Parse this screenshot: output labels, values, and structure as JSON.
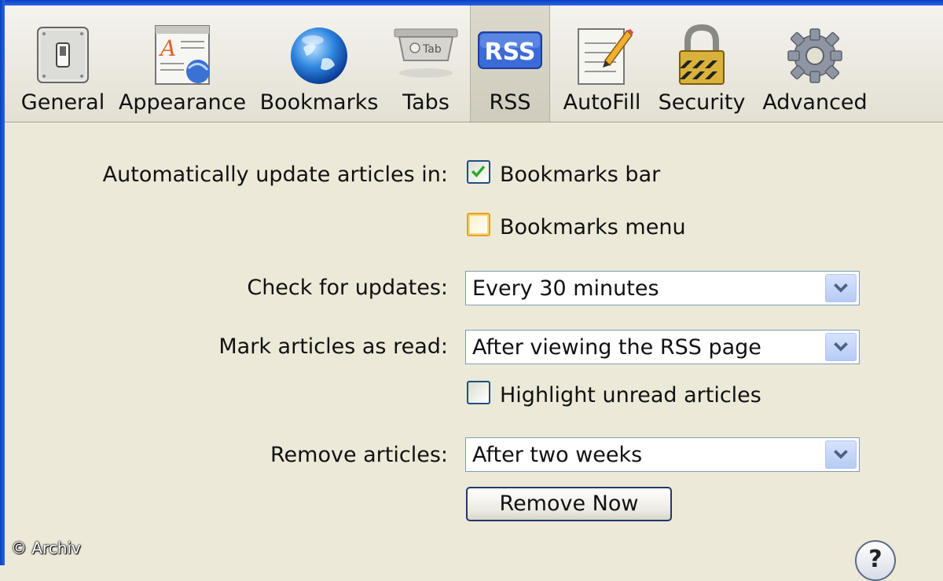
{
  "toolbar": {
    "items": [
      {
        "label": "General",
        "icon": "light-switch-icon"
      },
      {
        "label": "Appearance",
        "icon": "font-document-icon"
      },
      {
        "label": "Bookmarks",
        "icon": "globe-icon"
      },
      {
        "label": "Tabs",
        "icon": "tab-icon"
      },
      {
        "label": "RSS",
        "icon": "rss-icon",
        "selected": true
      },
      {
        "label": "AutoFill",
        "icon": "pencil-form-icon"
      },
      {
        "label": "Security",
        "icon": "padlock-icon"
      },
      {
        "label": "Advanced",
        "icon": "gear-icon"
      }
    ],
    "tab_icon_text": "Tab",
    "rss_icon_text": "RSS"
  },
  "rss": {
    "auto_update_label": "Automatically update articles in:",
    "bookmarks_bar": {
      "label": "Bookmarks bar",
      "checked": true
    },
    "bookmarks_menu": {
      "label": "Bookmarks menu",
      "checked": false
    },
    "check_updates_label": "Check for updates:",
    "check_updates_value": "Every 30 minutes",
    "mark_read_label": "Mark articles as read:",
    "mark_read_value": "After viewing the RSS page",
    "highlight_unread": {
      "label": "Highlight unread articles",
      "checked": false
    },
    "remove_articles_label": "Remove articles:",
    "remove_articles_value": "After two weeks",
    "remove_now_label": "Remove Now"
  },
  "help_label": "?",
  "watermark": "© Archiv",
  "colors": {
    "window_bg": "#ece9d8",
    "frame_blue": "#2a62e6",
    "checkmark_green": "#2ba82b",
    "rss_blue": "#3b6bd6"
  }
}
